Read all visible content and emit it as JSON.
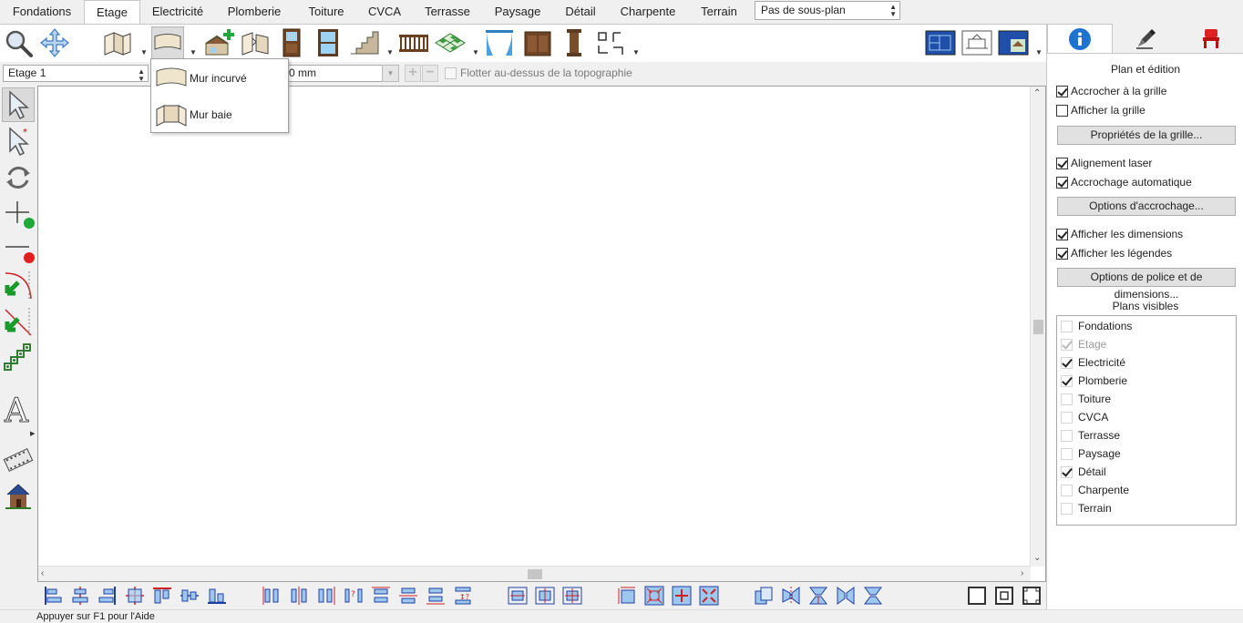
{
  "tabs": [
    {
      "label": "Fondations",
      "active": false
    },
    {
      "label": "Etage",
      "active": true
    },
    {
      "label": "Electricité",
      "active": false
    },
    {
      "label": "Plomberie",
      "active": false
    },
    {
      "label": "Toiture",
      "active": false
    },
    {
      "label": "CVCA",
      "active": false
    },
    {
      "label": "Terrasse",
      "active": false
    },
    {
      "label": "Paysage",
      "active": false
    },
    {
      "label": "Détail",
      "active": false
    },
    {
      "label": "Charpente",
      "active": false
    },
    {
      "label": "Terrain",
      "active": false
    }
  ],
  "subplan_select": {
    "value": "Pas de sous-plan"
  },
  "toolbar": {
    "icons": [
      "zoom-icon",
      "pan-icon",
      "straight-wall-icon",
      "curved-wall-icon",
      "room-add-icon",
      "wall-break-icon",
      "door-icon",
      "window-icon",
      "stairs-icon",
      "railing-icon",
      "floor-pattern-icon",
      "curtain-icon",
      "cabinet-icon",
      "column-icon",
      "dimension-tools-icon",
      "plan-view-icon",
      "section-view-icon",
      "3d-view-icon"
    ]
  },
  "floor_select": {
    "value": "Etage 1"
  },
  "offset_input": {
    "value": "0 mm"
  },
  "float_topo": {
    "label": "Flotter au-dessus de la topographie",
    "checked": false
  },
  "wall_menu": {
    "items": [
      {
        "label": "Mur incurvé",
        "icon": "curved-wall-icon"
      },
      {
        "label": "Mur baie",
        "icon": "bay-wall-icon"
      }
    ]
  },
  "left_tools": [
    "select-arrow-icon",
    "select-add-icon",
    "rotate-icon",
    "add-point-icon",
    "delete-point-icon",
    "arc-inward-icon",
    "arc-outward-icon",
    "chain-icon",
    "text-icon",
    "film-icon",
    "house-icon"
  ],
  "status_text": "Appuyer sur F1 pour l'Aide",
  "right_panel": {
    "tabs": [
      "info-icon",
      "pen-icon",
      "chair-icon"
    ],
    "title": "Plan et édition",
    "snap_grid": {
      "label": "Accrocher à la grille",
      "checked": true
    },
    "show_grid": {
      "label": "Afficher la grille",
      "checked": false
    },
    "grid_props_button": "Propriétés de la grille...",
    "laser_align": {
      "label": "Alignement laser",
      "checked": true
    },
    "auto_snap": {
      "label": "Accrochage automatique",
      "checked": true
    },
    "snap_options_button": "Options d'accrochage...",
    "show_dimensions": {
      "label": "Afficher les dimensions",
      "checked": true
    },
    "show_labels": {
      "label": "Afficher les légendes",
      "checked": true
    },
    "font_dim_button": "Options de police et de dimensions...",
    "visible_plans_title": "Plans visibles",
    "visible_plans": [
      {
        "label": "Fondations",
        "state": "off"
      },
      {
        "label": "Etage",
        "state": "disabled"
      },
      {
        "label": "Electricité",
        "state": "on"
      },
      {
        "label": "Plomberie",
        "state": "on"
      },
      {
        "label": "Toiture",
        "state": "off"
      },
      {
        "label": "CVCA",
        "state": "off"
      },
      {
        "label": "Terrasse",
        "state": "off"
      },
      {
        "label": "Paysage",
        "state": "off"
      },
      {
        "label": "Détail",
        "state": "on"
      },
      {
        "label": "Charpente",
        "state": "off"
      },
      {
        "label": "Terrain",
        "state": "off"
      }
    ]
  },
  "colors": {
    "accent": "#1e73d2",
    "canvas": "#ffffff",
    "panel": "#f0f0f0"
  }
}
